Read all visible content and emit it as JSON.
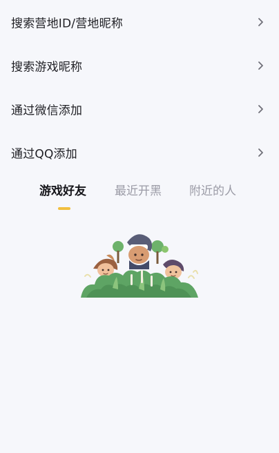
{
  "menu": {
    "items": [
      {
        "label": "搜索营地ID/营地昵称"
      },
      {
        "label": "搜索游戏昵称"
      },
      {
        "label": "通过微信添加"
      },
      {
        "label": "通过QQ添加"
      }
    ]
  },
  "tabs": [
    {
      "label": "游戏好友",
      "active": true
    },
    {
      "label": "最近开黑",
      "active": false
    },
    {
      "label": "附近的人",
      "active": false
    }
  ],
  "colors": {
    "background": "#f6f7fb",
    "active_tab_indicator": "#f1bf3f",
    "inactive_tab_text": "#9b9ba6"
  },
  "icons": {
    "row_arrow": "chevron-right-icon",
    "empty_state": "friends-in-bushes-illustration"
  }
}
